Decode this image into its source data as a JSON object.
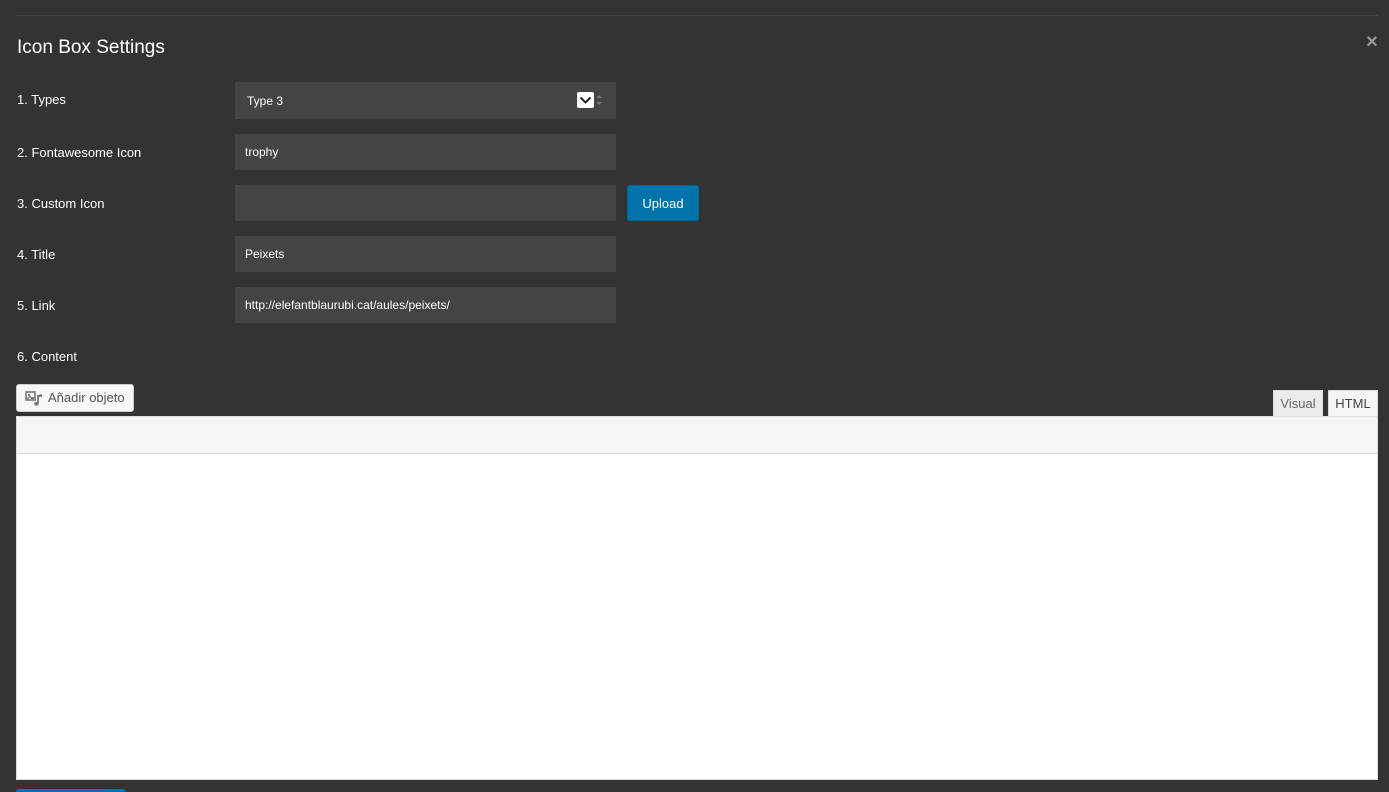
{
  "dialog": {
    "title": "Icon Box Settings",
    "close_symbol": "×"
  },
  "fields": {
    "types": {
      "label": "1. Types",
      "value": "Type 3"
    },
    "fontawesome_icon": {
      "label": "2. Fontawesome Icon",
      "value": "trophy",
      "placeholder": ""
    },
    "custom_icon": {
      "label": "3. Custom Icon",
      "value": "",
      "placeholder": "",
      "upload_label": "Upload"
    },
    "title": {
      "label": "4. Title",
      "value": "Peixets",
      "placeholder": ""
    },
    "link": {
      "label": "5. Link",
      "value": "http://elefantblaurubi.cat/aules/peixets/",
      "placeholder": ""
    },
    "content": {
      "label": "6. Content"
    }
  },
  "editor": {
    "add_media_label": "Añadir objeto",
    "tabs": [
      {
        "label": "Visual",
        "active": false
      },
      {
        "label": "HTML",
        "active": true
      }
    ],
    "content": ""
  },
  "icons": {
    "close": "close-icon",
    "select_arrow": "chevron-down-icon",
    "add_media": "media-icon"
  },
  "colors": {
    "background": "#333333",
    "input_background": "#444444",
    "primary_button": "#0073aa",
    "editor_background": "#ffffff",
    "toolbar_background": "#f5f5f5"
  }
}
